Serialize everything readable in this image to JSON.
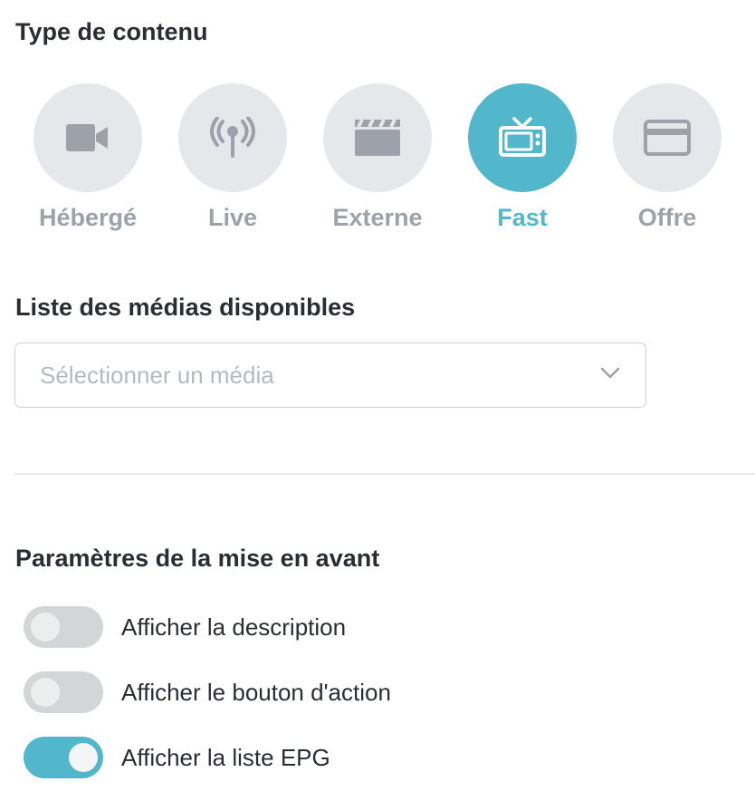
{
  "content_type": {
    "title": "Type de contenu",
    "options": [
      {
        "label": "Hébergé",
        "icon": "video-camera-icon",
        "selected": false
      },
      {
        "label": "Live",
        "icon": "broadcast-icon",
        "selected": false
      },
      {
        "label": "Externe",
        "icon": "clapperboard-icon",
        "selected": false
      },
      {
        "label": "Fast",
        "icon": "tv-icon",
        "selected": true
      },
      {
        "label": "Offre",
        "icon": "credit-card-icon",
        "selected": false
      }
    ]
  },
  "media_list": {
    "title": "Liste des médias disponibles",
    "select": {
      "placeholder": "Sélectionner un média",
      "value": ""
    }
  },
  "highlight_settings": {
    "title": "Paramètres de la mise en avant",
    "toggles": [
      {
        "label": "Afficher la description",
        "enabled": false
      },
      {
        "label": "Afficher le bouton d'action",
        "enabled": false
      },
      {
        "label": "Afficher la liste EPG",
        "enabled": true
      }
    ]
  },
  "colors": {
    "accent": "#52b7ca",
    "inactive_icon": "#9da1a9",
    "inactive_circle": "#e6e7eb",
    "toggle_off": "#d4d5d7"
  }
}
